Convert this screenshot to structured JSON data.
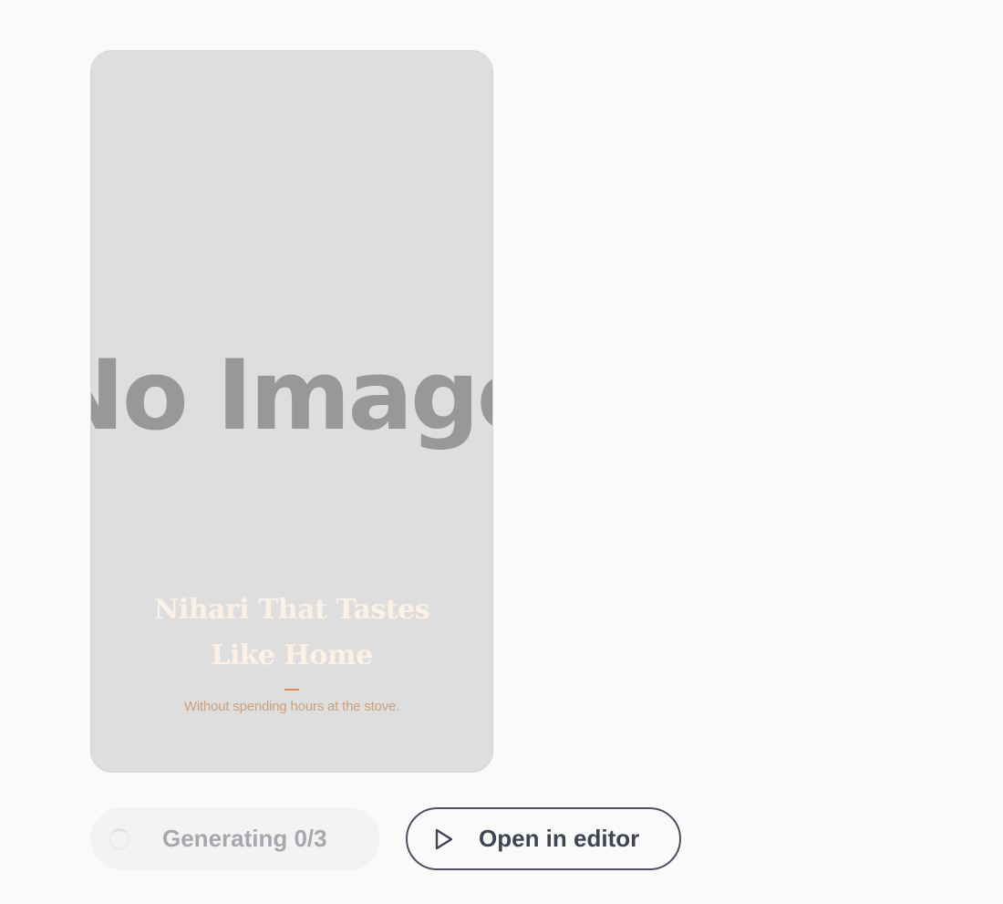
{
  "preview": {
    "placeholder_text": "No Image",
    "title": "Nihari That Tastes Like Home",
    "subtitle": "Without spending hours at the stove."
  },
  "status": {
    "label": "Generating 0/3"
  },
  "actions": {
    "open_editor_label": "Open in editor"
  },
  "colors": {
    "title_text": "#fbf1e6",
    "subtitle_text": "#c9a27d",
    "accent_line": "#e6855a",
    "button_border": "#4a5060"
  },
  "icons": {
    "spinner": "loading-spinner-icon",
    "play": "play-icon"
  }
}
